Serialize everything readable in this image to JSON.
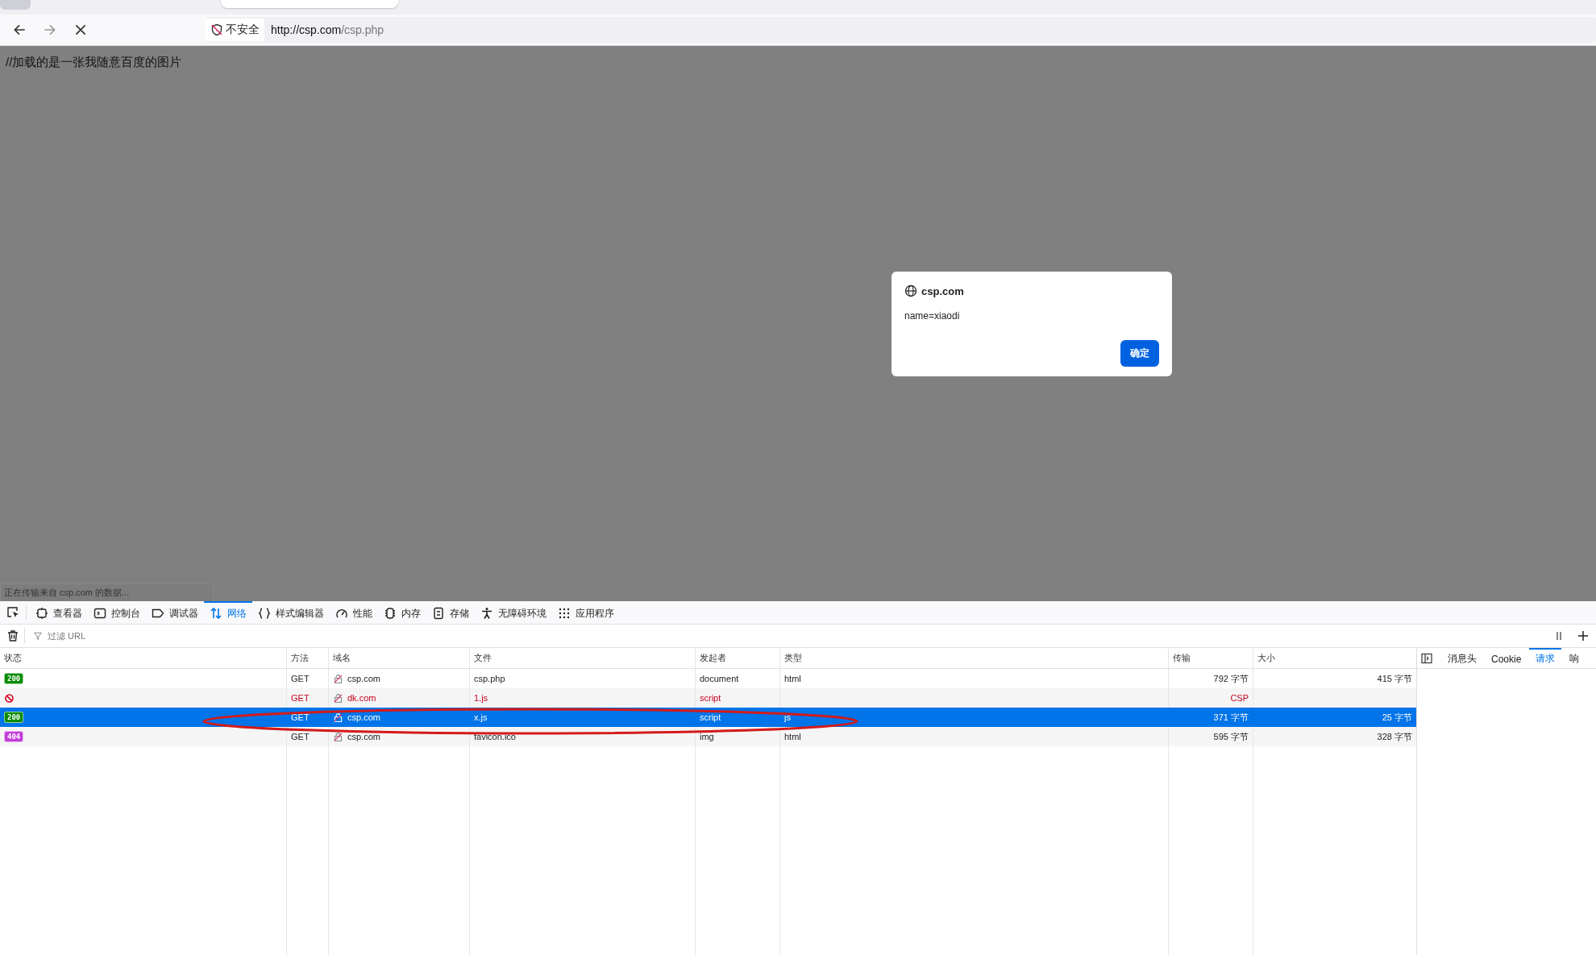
{
  "browser": {
    "security_label": "不安全",
    "url_host": "http://csp.com",
    "url_path": "/csp.php"
  },
  "page": {
    "text": "//加载的是一张我随意百度的图片",
    "status": "正在传输来自 csp.com 的数据..."
  },
  "dialog": {
    "origin": "csp.com",
    "message": "name=xiaodi",
    "button": "确定"
  },
  "devtools": {
    "tabs": [
      {
        "label": "查看器",
        "selected": false
      },
      {
        "label": "控制台",
        "selected": false
      },
      {
        "label": "调试器",
        "selected": false
      },
      {
        "label": "网络",
        "selected": true
      },
      {
        "label": "样式编辑器",
        "selected": false
      },
      {
        "label": "性能",
        "selected": false
      },
      {
        "label": "内存",
        "selected": false
      },
      {
        "label": "存储",
        "selected": false
      },
      {
        "label": "无障碍环境",
        "selected": false
      },
      {
        "label": "应用程序",
        "selected": false
      }
    ],
    "filter": {
      "placeholder": "过滤 URL"
    },
    "table": {
      "columns": [
        "状态",
        "方法",
        "域名",
        "文件",
        "发起者",
        "类型",
        "传输",
        "大小"
      ],
      "rows": [
        {
          "kind": "code",
          "status": "200",
          "color": "#058b00",
          "method": "GET",
          "domain": "csp.com",
          "file": "csp.php",
          "initiator": "document",
          "type": "html",
          "transfer": "792 字节",
          "size": "415 字节",
          "blocked": false,
          "selected": false
        },
        {
          "kind": "blocked",
          "method": "GET",
          "domain": "dk.com",
          "file": "1.js",
          "initiator": "script",
          "transfer": "CSP",
          "blocked": true,
          "selected": false
        },
        {
          "kind": "code",
          "status": "200",
          "color": "#058b00",
          "method": "GET",
          "domain": "csp.com",
          "file": "x.js",
          "initiator": "script",
          "type": "js",
          "transfer": "371 字节",
          "size": "25 字节",
          "blocked": false,
          "selected": true
        },
        {
          "kind": "code",
          "status": "404",
          "color": "#c23fd7",
          "method": "GET",
          "domain": "csp.com",
          "file": "favicon.ico",
          "initiator": "img",
          "type": "html",
          "transfer": "595 字节",
          "size": "328 字节",
          "blocked": false,
          "selected": false
        }
      ]
    },
    "side_tabs": [
      {
        "label": "消息头",
        "selected": false
      },
      {
        "label": "Cookie",
        "selected": false
      },
      {
        "label": "请求",
        "selected": true
      },
      {
        "label": "响",
        "selected": false
      }
    ]
  }
}
